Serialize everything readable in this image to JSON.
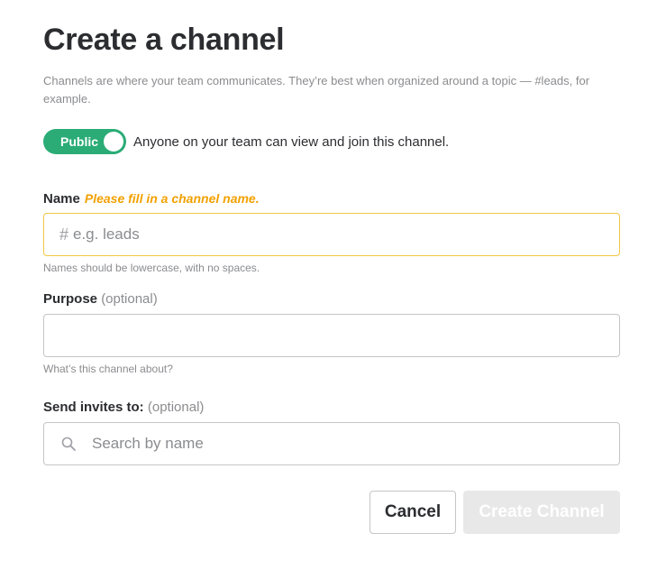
{
  "dialog": {
    "title": "Create a channel",
    "intro": "Channels are where your team communicates. They’re best when organized around a topic — #leads, for example."
  },
  "visibility": {
    "toggle_label": "Public",
    "toggle_on": true,
    "description": "Anyone on your team can view and join this channel.",
    "toggle_color": "#2bac76"
  },
  "name_field": {
    "label": "Name",
    "error": "Please fill in a channel name.",
    "prefix": "#",
    "value": "",
    "placeholder": "e.g. leads",
    "help": "Names should be lowercase, with no spaces.",
    "border_color": "#f2c744"
  },
  "purpose_field": {
    "label": "Purpose",
    "optional": "(optional)",
    "value": "",
    "placeholder": "",
    "help": "What’s this channel about?"
  },
  "invite_field": {
    "label": "Send invites to:",
    "optional": "(optional)",
    "icon": "search-icon",
    "value": "",
    "placeholder": "Search by name"
  },
  "actions": {
    "cancel_label": "Cancel",
    "create_label": "Create Channel",
    "create_disabled": true
  }
}
